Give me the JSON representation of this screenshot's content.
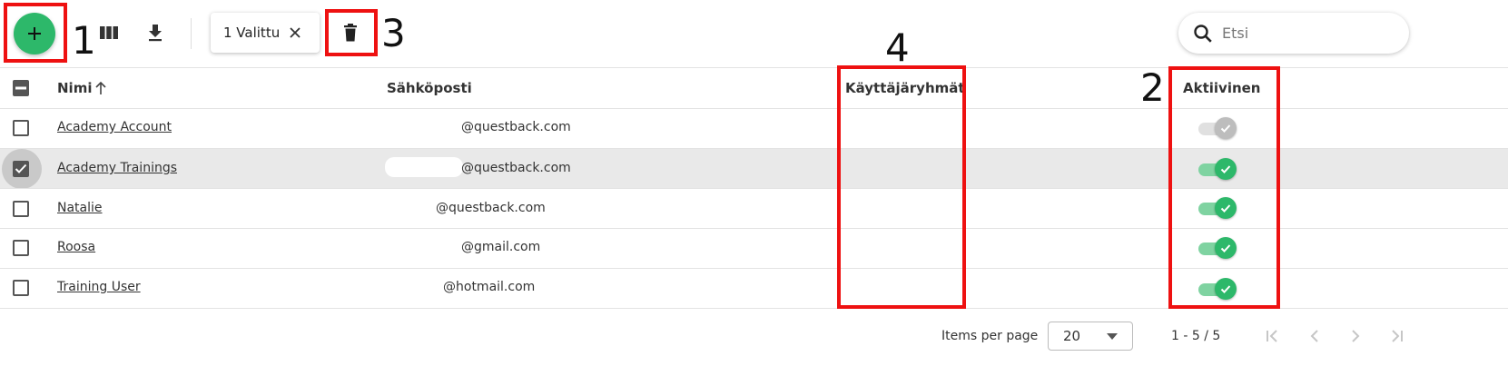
{
  "toolbar": {
    "add_icon": "plus-icon",
    "columns_icon": "view-column-icon",
    "download_icon": "download-icon",
    "selection_chip": {
      "label": "1 Valittu",
      "close_icon": "close-icon"
    },
    "delete_icon": "trash-icon",
    "search": {
      "placeholder": "Etsi",
      "value": "",
      "icon": "search-icon"
    }
  },
  "annotations": [
    "1",
    "2",
    "3",
    "4"
  ],
  "table": {
    "columns": {
      "name": "Nimi",
      "name_sort_icon": "arrow-up-icon",
      "email": "Sähköposti",
      "groups": "Käyttäjäryhmät",
      "active": "Aktiivinen"
    },
    "header_checkbox_state": "indeterminate",
    "rows": [
      {
        "name": "Academy Account",
        "email": "@questback.com",
        "groups": "",
        "selected": false,
        "active": true,
        "toggle_enabled": false
      },
      {
        "name": "Academy Trainings",
        "email": "@questback.com",
        "groups": "",
        "selected": true,
        "active": true,
        "toggle_enabled": true
      },
      {
        "name": "Natalie",
        "email": "@questback.com",
        "groups": "",
        "selected": false,
        "active": true,
        "toggle_enabled": true
      },
      {
        "name": "Roosa",
        "email": "@gmail.com",
        "groups": "",
        "selected": false,
        "active": true,
        "toggle_enabled": true
      },
      {
        "name": "Training User",
        "email": "@hotmail.com",
        "groups": "",
        "selected": false,
        "active": true,
        "toggle_enabled": true
      }
    ]
  },
  "pagination": {
    "items_per_page_label": "Items per page",
    "items_per_page_value": "20",
    "range_label": "1 - 5 / 5",
    "icons": [
      "first-page-icon",
      "previous-page-icon",
      "next-page-icon",
      "last-page-icon"
    ]
  },
  "colors": {
    "accent": "#2db86a",
    "annotation_red": "#ee1111",
    "selected_row": "#e9e9e9"
  }
}
